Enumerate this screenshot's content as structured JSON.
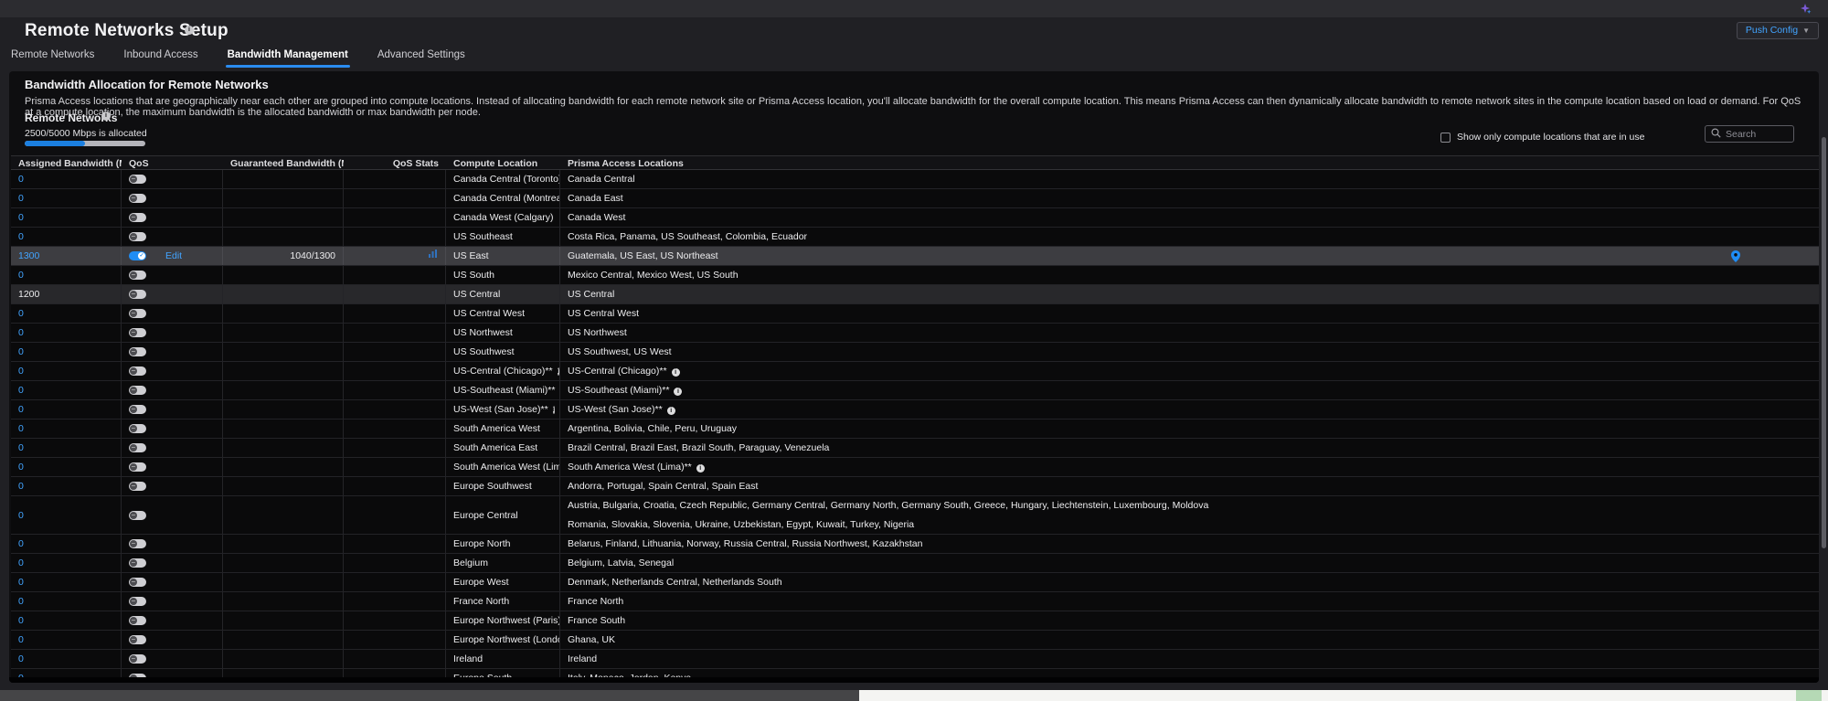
{
  "topbar": {
    "copilot_icon": "sparkle-icon"
  },
  "header": {
    "title": "Remote Networks Setup",
    "push_config_label": "Push Config"
  },
  "tabs": [
    {
      "label": "Remote Networks",
      "active": false
    },
    {
      "label": "Inbound Access",
      "active": false
    },
    {
      "label": "Bandwidth Management",
      "active": true
    },
    {
      "label": "Advanced Settings",
      "active": false
    }
  ],
  "panel": {
    "heading": "Bandwidth Allocation for Remote Networks",
    "description": "Prisma Access locations that are geographically near each other are grouped into compute locations. Instead of allocating bandwidth for each remote network site or Prisma Access location, you'll allocate bandwidth for the overall compute location. This means Prisma Access can then dynamically allocate bandwidth to remote network sites in the compute location based on load or demand. For QoS at a compute location, the maximum bandwidth is the allocated bandwidth or max bandwidth per node.",
    "remote_networks_label": "Remote Networks",
    "allocation_text": "2500/5000 Mbps is allocated",
    "allocated_mbps": 2500,
    "total_mbps": 5000,
    "allocated_percent": 50,
    "filter_checkbox_label": "Show only compute locations that are in use",
    "filter_checkbox_checked": false,
    "search_placeholder": "Search"
  },
  "table": {
    "columns": [
      "Assigned Bandwidth (Mbps)",
      "QoS",
      "Guaranteed Bandwidth (Mb...",
      "QoS Stats",
      "Compute Location",
      "Prisma Access Locations"
    ],
    "rows": [
      {
        "assigned": "0",
        "assigned_is_link": true,
        "qos_on": false,
        "edit_label": null,
        "guaranteed": "",
        "has_stats_icon": false,
        "compute": "Canada Central (Toronto)",
        "compute_info": false,
        "locations": "Canada Central",
        "locations_line2": null,
        "locations_info": false,
        "highlight": false,
        "shade": false,
        "pin": false
      },
      {
        "assigned": "0",
        "assigned_is_link": true,
        "qos_on": false,
        "edit_label": null,
        "guaranteed": "",
        "has_stats_icon": false,
        "compute": "Canada Central (Montreal)",
        "compute_info": false,
        "locations": "Canada East",
        "locations_line2": null,
        "locations_info": false,
        "highlight": false,
        "shade": false,
        "pin": false
      },
      {
        "assigned": "0",
        "assigned_is_link": true,
        "qos_on": false,
        "edit_label": null,
        "guaranteed": "",
        "has_stats_icon": false,
        "compute": "Canada West (Calgary)",
        "compute_info": false,
        "locations": "Canada West",
        "locations_line2": null,
        "locations_info": false,
        "highlight": false,
        "shade": false,
        "pin": false
      },
      {
        "assigned": "0",
        "assigned_is_link": true,
        "qos_on": false,
        "edit_label": null,
        "guaranteed": "",
        "has_stats_icon": false,
        "compute": "US Southeast",
        "compute_info": false,
        "locations": "Costa Rica, Panama, US Southeast, Colombia, Ecuador",
        "locations_line2": null,
        "locations_info": false,
        "highlight": false,
        "shade": false,
        "pin": false
      },
      {
        "assigned": "1300",
        "assigned_is_link": true,
        "qos_on": true,
        "edit_label": "Edit",
        "guaranteed": "1040/1300",
        "has_stats_icon": true,
        "compute": "US East",
        "compute_info": false,
        "locations": "Guatemala, US East, US Northeast",
        "locations_line2": null,
        "locations_info": false,
        "highlight": true,
        "shade": false,
        "pin": true
      },
      {
        "assigned": "0",
        "assigned_is_link": true,
        "qos_on": false,
        "edit_label": null,
        "guaranteed": "",
        "has_stats_icon": false,
        "compute": "US South",
        "compute_info": false,
        "locations": "Mexico Central, Mexico West, US South",
        "locations_line2": null,
        "locations_info": false,
        "highlight": false,
        "shade": false,
        "pin": false
      },
      {
        "assigned": "1200",
        "assigned_is_link": false,
        "qos_on": false,
        "edit_label": null,
        "guaranteed": "",
        "has_stats_icon": false,
        "compute": "US Central",
        "compute_info": false,
        "locations": "US Central",
        "locations_line2": null,
        "locations_info": false,
        "highlight": false,
        "shade": true,
        "pin": false
      },
      {
        "assigned": "0",
        "assigned_is_link": true,
        "qos_on": false,
        "edit_label": null,
        "guaranteed": "",
        "has_stats_icon": false,
        "compute": "US Central West",
        "compute_info": false,
        "locations": "US Central West",
        "locations_line2": null,
        "locations_info": false,
        "highlight": false,
        "shade": false,
        "pin": false
      },
      {
        "assigned": "0",
        "assigned_is_link": true,
        "qos_on": false,
        "edit_label": null,
        "guaranteed": "",
        "has_stats_icon": false,
        "compute": "US Northwest",
        "compute_info": false,
        "locations": "US Northwest",
        "locations_line2": null,
        "locations_info": false,
        "highlight": false,
        "shade": false,
        "pin": false
      },
      {
        "assigned": "0",
        "assigned_is_link": true,
        "qos_on": false,
        "edit_label": null,
        "guaranteed": "",
        "has_stats_icon": false,
        "compute": "US Southwest",
        "compute_info": false,
        "locations": "US Southwest, US West",
        "locations_line2": null,
        "locations_info": false,
        "highlight": false,
        "shade": false,
        "pin": false
      },
      {
        "assigned": "0",
        "assigned_is_link": true,
        "qos_on": false,
        "edit_label": null,
        "guaranteed": "",
        "has_stats_icon": false,
        "compute": "US-Central (Chicago)**",
        "compute_info": true,
        "locations": "US-Central (Chicago)**",
        "locations_line2": null,
        "locations_info": true,
        "highlight": false,
        "shade": false,
        "pin": false
      },
      {
        "assigned": "0",
        "assigned_is_link": true,
        "qos_on": false,
        "edit_label": null,
        "guaranteed": "",
        "has_stats_icon": false,
        "compute": "US-Southeast (Miami)**",
        "compute_info": true,
        "locations": "US-Southeast (Miami)**",
        "locations_line2": null,
        "locations_info": true,
        "highlight": false,
        "shade": false,
        "pin": false
      },
      {
        "assigned": "0",
        "assigned_is_link": true,
        "qos_on": false,
        "edit_label": null,
        "guaranteed": "",
        "has_stats_icon": false,
        "compute": "US-West (San Jose)**",
        "compute_info": true,
        "locations": "US-West (San Jose)**",
        "locations_line2": null,
        "locations_info": true,
        "highlight": false,
        "shade": false,
        "pin": false
      },
      {
        "assigned": "0",
        "assigned_is_link": true,
        "qos_on": false,
        "edit_label": null,
        "guaranteed": "",
        "has_stats_icon": false,
        "compute": "South America West",
        "compute_info": false,
        "locations": "Argentina, Bolivia, Chile, Peru, Uruguay",
        "locations_line2": null,
        "locations_info": false,
        "highlight": false,
        "shade": false,
        "pin": false
      },
      {
        "assigned": "0",
        "assigned_is_link": true,
        "qos_on": false,
        "edit_label": null,
        "guaranteed": "",
        "has_stats_icon": false,
        "compute": "South America East",
        "compute_info": false,
        "locations": "Brazil Central, Brazil East, Brazil South, Paraguay, Venezuela",
        "locations_line2": null,
        "locations_info": false,
        "highlight": false,
        "shade": false,
        "pin": false
      },
      {
        "assigned": "0",
        "assigned_is_link": true,
        "qos_on": false,
        "edit_label": null,
        "guaranteed": "",
        "has_stats_icon": false,
        "compute": "South America West (Lima)**",
        "compute_info": true,
        "locations": "South America West (Lima)**",
        "locations_line2": null,
        "locations_info": true,
        "highlight": false,
        "shade": false,
        "pin": false
      },
      {
        "assigned": "0",
        "assigned_is_link": true,
        "qos_on": false,
        "edit_label": null,
        "guaranteed": "",
        "has_stats_icon": false,
        "compute": "Europe Southwest",
        "compute_info": false,
        "locations": "Andorra, Portugal, Spain Central, Spain East",
        "locations_line2": null,
        "locations_info": false,
        "highlight": false,
        "shade": false,
        "pin": false
      },
      {
        "assigned": "0",
        "assigned_is_link": true,
        "qos_on": false,
        "edit_label": null,
        "guaranteed": "",
        "has_stats_icon": false,
        "compute": "Europe Central",
        "compute_info": false,
        "locations": "Austria, Bulgaria, Croatia, Czech Republic, Germany Central, Germany North, Germany South, Greece, Hungary, Liechtenstein, Luxembourg, Moldova",
        "locations_line2": "Romania, Slovakia, Slovenia, Ukraine, Uzbekistan, Egypt, Kuwait, Turkey, Nigeria",
        "locations_info": false,
        "highlight": false,
        "shade": false,
        "pin": false
      },
      {
        "assigned": "0",
        "assigned_is_link": true,
        "qos_on": false,
        "edit_label": null,
        "guaranteed": "",
        "has_stats_icon": false,
        "compute": "Europe North",
        "compute_info": false,
        "locations": "Belarus, Finland, Lithuania, Norway, Russia Central, Russia Northwest, Kazakhstan",
        "locations_line2": null,
        "locations_info": false,
        "highlight": false,
        "shade": false,
        "pin": false
      },
      {
        "assigned": "0",
        "assigned_is_link": true,
        "qos_on": false,
        "edit_label": null,
        "guaranteed": "",
        "has_stats_icon": false,
        "compute": "Belgium",
        "compute_info": false,
        "locations": "Belgium, Latvia, Senegal",
        "locations_line2": null,
        "locations_info": false,
        "highlight": false,
        "shade": false,
        "pin": false
      },
      {
        "assigned": "0",
        "assigned_is_link": true,
        "qos_on": false,
        "edit_label": null,
        "guaranteed": "",
        "has_stats_icon": false,
        "compute": "Europe West",
        "compute_info": false,
        "locations": "Denmark, Netherlands Central, Netherlands South",
        "locations_line2": null,
        "locations_info": false,
        "highlight": false,
        "shade": false,
        "pin": false
      },
      {
        "assigned": "0",
        "assigned_is_link": true,
        "qos_on": false,
        "edit_label": null,
        "guaranteed": "",
        "has_stats_icon": false,
        "compute": "France North",
        "compute_info": false,
        "locations": "France North",
        "locations_line2": null,
        "locations_info": false,
        "highlight": false,
        "shade": false,
        "pin": false
      },
      {
        "assigned": "0",
        "assigned_is_link": true,
        "qos_on": false,
        "edit_label": null,
        "guaranteed": "",
        "has_stats_icon": false,
        "compute": "Europe Northwest (Paris)",
        "compute_info": false,
        "locations": "France South",
        "locations_line2": null,
        "locations_info": false,
        "highlight": false,
        "shade": false,
        "pin": false
      },
      {
        "assigned": "0",
        "assigned_is_link": true,
        "qos_on": false,
        "edit_label": null,
        "guaranteed": "",
        "has_stats_icon": false,
        "compute": "Europe Northwest (London)",
        "compute_info": false,
        "locations": "Ghana, UK",
        "locations_line2": null,
        "locations_info": false,
        "highlight": false,
        "shade": false,
        "pin": false
      },
      {
        "assigned": "0",
        "assigned_is_link": true,
        "qos_on": false,
        "edit_label": null,
        "guaranteed": "",
        "has_stats_icon": false,
        "compute": "Ireland",
        "compute_info": false,
        "locations": "Ireland",
        "locations_line2": null,
        "locations_info": false,
        "highlight": false,
        "shade": false,
        "pin": false
      },
      {
        "assigned": "0",
        "assigned_is_link": true,
        "qos_on": false,
        "edit_label": null,
        "guaranteed": "",
        "has_stats_icon": false,
        "compute": "Europe South",
        "compute_info": false,
        "locations": "Italy, Monaco, Jordan, Kenya",
        "locations_line2": null,
        "locations_info": false,
        "highlight": false,
        "shade": false,
        "pin": false
      }
    ]
  },
  "colors": {
    "accent_blue": "#42a4ff",
    "toggle_on_blue": "#1f8df5",
    "tab_underline_blue": "#2b8cf0",
    "progress_blue": "#1b7fe0",
    "progress_track": "#b4b4ba",
    "panel_bg": "#0e0e10",
    "page_bg": "#202024",
    "row_bg": "#0a0a0b",
    "row_highlight_bg": "#3d3d41",
    "row_shade_bg": "#28282b",
    "bottom_strip_white": "#f4f4f2",
    "bottom_strip_green": "#b5d9b5",
    "sparkle_purple": "#7b5bd6"
  }
}
